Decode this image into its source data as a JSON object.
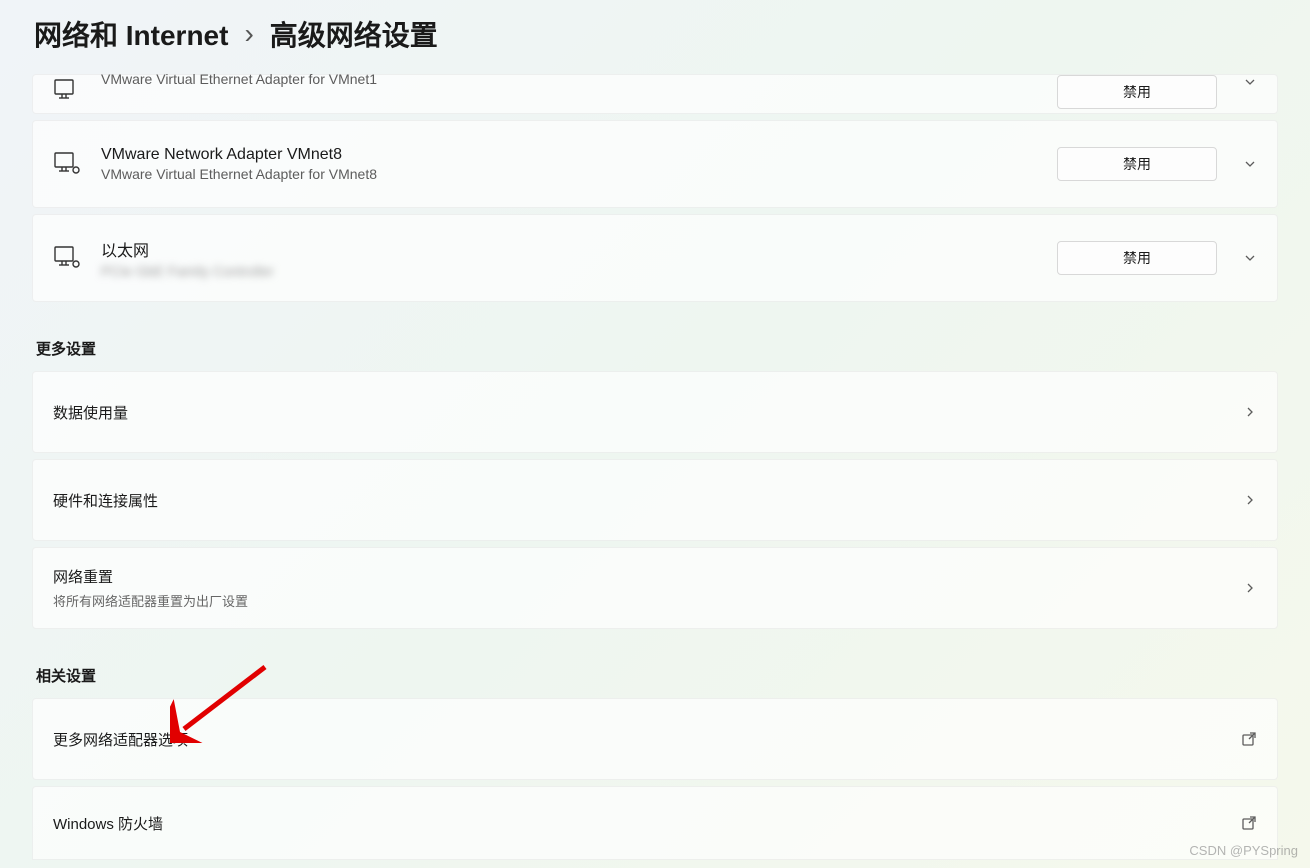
{
  "breadcrumb": {
    "parent": "网络和 Internet",
    "separator": "›",
    "current": "高级网络设置"
  },
  "adapters": [
    {
      "title": "",
      "subtitle": "VMware Virtual Ethernet Adapter for VMnet1",
      "button": "禁用"
    },
    {
      "title": "VMware Network Adapter VMnet8",
      "subtitle": "VMware Virtual Ethernet Adapter for VMnet8",
      "button": "禁用"
    },
    {
      "title": "以太网",
      "subtitle": "PCIe GbE Family Controller",
      "button": "禁用"
    }
  ],
  "sections": {
    "more_settings": "更多设置",
    "related_settings": "相关设置"
  },
  "more_items": [
    {
      "title": "数据使用量",
      "sub": ""
    },
    {
      "title": "硬件和连接属性",
      "sub": ""
    },
    {
      "title": "网络重置",
      "sub": "将所有网络适配器重置为出厂设置"
    }
  ],
  "related_items": [
    {
      "title": "更多网络适配器选项"
    },
    {
      "title": "Windows 防火墙"
    }
  ],
  "watermark": "CSDN @PYSpring"
}
